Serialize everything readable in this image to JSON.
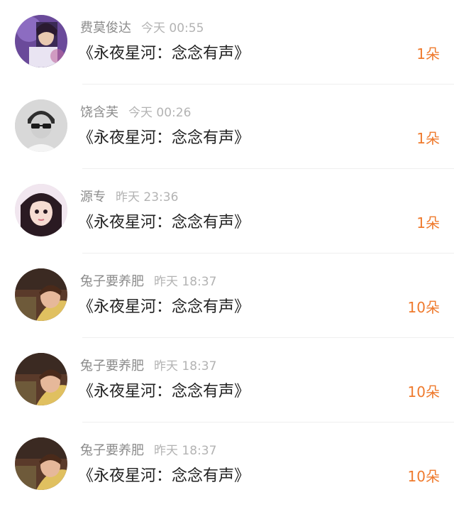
{
  "colors": {
    "name": "#8c8c8c",
    "time": "#b3b3b3",
    "title": "#222222",
    "gift": "#ef7a2d",
    "divider": "#eeeeee"
  },
  "items": [
    {
      "name": "费莫俊达",
      "time": "今天 00:55",
      "title": "《永夜星河：念念有声》",
      "gift": "1朵",
      "avatar_icon": "purple-photo-avatar-icon"
    },
    {
      "name": "饶含芙",
      "time": "今天 00:26",
      "title": "《永夜星河：念念有声》",
      "gift": "1朵",
      "avatar_icon": "grayscale-man-avatar-icon"
    },
    {
      "name": "源专",
      "time": "昨天 23:36",
      "title": "《永夜星河：念念有声》",
      "gift": "1朵",
      "avatar_icon": "girl-avatar-icon"
    },
    {
      "name": "兔子要养肥",
      "time": "昨天 18:37",
      "title": "《永夜星河：念念有声》",
      "gift": "10朵",
      "avatar_icon": "boy-avatar-icon"
    },
    {
      "name": "兔子要养肥",
      "time": "昨天 18:37",
      "title": "《永夜星河：念念有声》",
      "gift": "10朵",
      "avatar_icon": "boy-avatar-icon"
    },
    {
      "name": "兔子要养肥",
      "time": "昨天 18:37",
      "title": "《永夜星河：念念有声》",
      "gift": "10朵",
      "avatar_icon": "boy-avatar-icon"
    }
  ]
}
